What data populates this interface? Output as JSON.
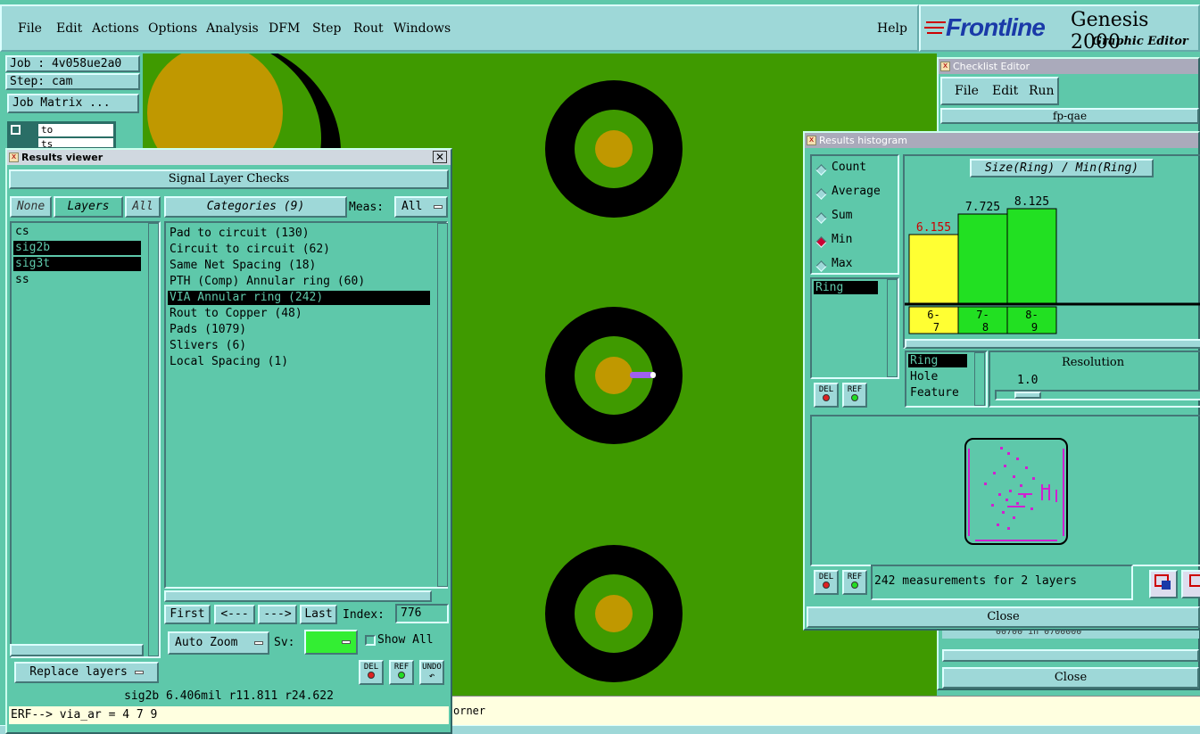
{
  "menu": {
    "items": [
      "File",
      "Edit",
      "Actions",
      "Options",
      "Analysis",
      "DFM",
      "Step",
      "Rout",
      "Windows"
    ],
    "help": "Help"
  },
  "logo": {
    "brand": "Frontline",
    "product": "Genesis 2000",
    "subtitle": "Graphic Editor"
  },
  "job": {
    "job_label": "Job : 4v058ue2a0",
    "step_label": "Step: cam",
    "matrix_button": "Job Matrix ...",
    "layer1": "to",
    "layer2": "ts"
  },
  "results_viewer": {
    "title": "Results viewer",
    "header": "Signal Layer Checks",
    "none_btn": "None",
    "layers_btn": "Layers",
    "all_btn": "All",
    "categories_btn": "Categories (9)",
    "meas_label": "Meas:",
    "meas_value": "All",
    "layers": [
      "cs",
      "sig2b",
      "sig3t",
      "ss"
    ],
    "categories": [
      "Pad to circuit (130)",
      "Circuit to circuit (62)",
      "Same Net Spacing (18)",
      "PTH (Comp) Annular ring (60)",
      "VIA Annular ring (242)",
      "Rout to Copper (48)",
      "Pads (1079)",
      "Slivers (6)",
      "Local Spacing (1)"
    ],
    "selected_category": 4,
    "first_btn": "First",
    "prev_btn": "<---",
    "next_btn": "--->",
    "last_btn": "Last",
    "index_label": "Index:",
    "index_value": "776",
    "auto_zoom": "Auto Zoom",
    "sv_label": "Sv:",
    "show_all": "Show All",
    "del": "DEL",
    "ref": "REF",
    "undo": "UNDO",
    "replace_layers": "Replace layers",
    "status": "sig2b  6.406mil  r11.811  r24.622",
    "erf": "ERF--> via_ar = 4 7 9"
  },
  "checklist": {
    "title": "Checklist Editor",
    "file": "File",
    "edit": "Edit",
    "run": "Run",
    "name": "fp-qae",
    "close": "Close",
    "coords": "00700  in     0700000"
  },
  "histogram": {
    "title": "Results histogram",
    "options": [
      "Count",
      "Average",
      "Sum",
      "Min",
      "Max"
    ],
    "selected_option": "Min",
    "chart_title": "Size(Ring) / Min(Ring)",
    "list_item": "Ring",
    "attr_list": [
      "Ring",
      "Hole",
      "Feature"
    ],
    "resolution_label": "Resolution",
    "resolution_value": "1.0",
    "measurements": "242 measurements for 2 layers",
    "close": "Close",
    "del": "DEL",
    "ref": "REF"
  },
  "chart_data": {
    "type": "bar",
    "title": "Size(Ring) / Min(Ring)",
    "categories": [
      "6-7",
      "7-8",
      "8-9"
    ],
    "values": [
      6.155,
      7.725,
      8.125
    ],
    "colors": [
      "#ffff33",
      "#22e022",
      "#22e022"
    ]
  },
  "bottom": {
    "orner": "orner"
  }
}
